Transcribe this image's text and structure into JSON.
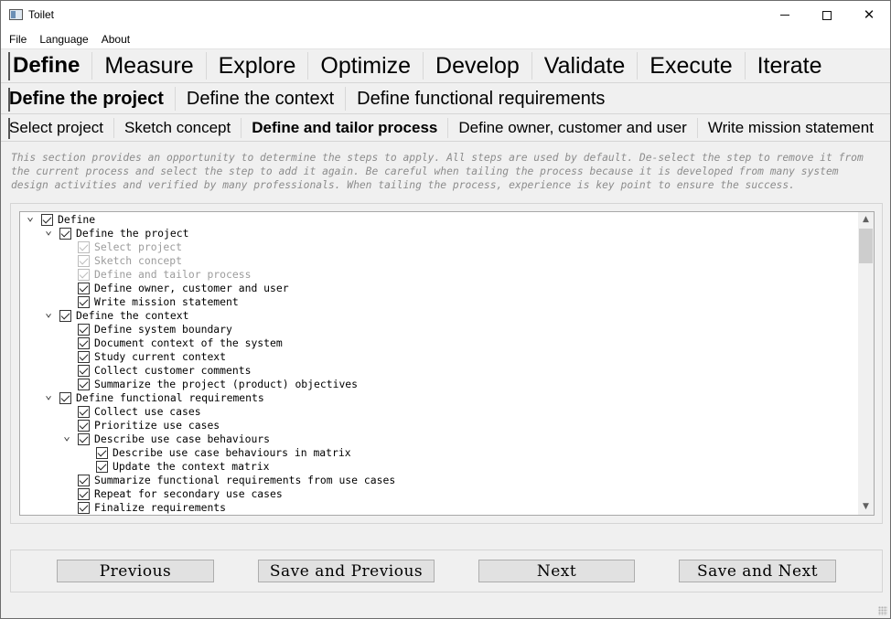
{
  "window": {
    "title": "Toilet"
  },
  "menu": [
    "File",
    "Language",
    "About"
  ],
  "phase_tabs": [
    "Define",
    "Measure",
    "Explore",
    "Optimize",
    "Develop",
    "Validate",
    "Execute",
    "Iterate"
  ],
  "phase_active": "Define",
  "step_tabs": [
    "Define the project",
    "Define the context",
    "Define functional requirements"
  ],
  "step_active": "Define the project",
  "substep_tabs": [
    "Select project",
    "Sketch concept",
    "Define and tailor process",
    "Define owner, customer and user",
    "Write mission statement"
  ],
  "substep_active": "Define and tailor process",
  "description": "This section provides an opportunity to determine the steps to apply. All steps are used by default. De-select the step to remove it from the current process and select the step to add it again. Be careful when tailing the process because it is developed from many system design activities and verified by many professionals. When tailing the process, experience is key point to ensure the success.",
  "tree": [
    {
      "label": "Define",
      "level": 0,
      "expanded": true,
      "checked": true,
      "disabled": false
    },
    {
      "label": "Define the project",
      "level": 1,
      "expanded": true,
      "checked": true,
      "disabled": false
    },
    {
      "label": "Select project",
      "level": 2,
      "checked": true,
      "disabled": true
    },
    {
      "label": "Sketch concept",
      "level": 2,
      "checked": true,
      "disabled": true
    },
    {
      "label": "Define and tailor process",
      "level": 2,
      "checked": true,
      "disabled": true
    },
    {
      "label": "Define owner, customer and user",
      "level": 2,
      "checked": true,
      "disabled": false
    },
    {
      "label": "Write mission statement",
      "level": 2,
      "checked": true,
      "disabled": false
    },
    {
      "label": "Define the context",
      "level": 1,
      "expanded": true,
      "checked": true,
      "disabled": false
    },
    {
      "label": "Define system boundary",
      "level": 2,
      "checked": true,
      "disabled": false
    },
    {
      "label": "Document context of the system",
      "level": 2,
      "checked": true,
      "disabled": false
    },
    {
      "label": "Study current context",
      "level": 2,
      "checked": true,
      "disabled": false
    },
    {
      "label": "Collect customer comments",
      "level": 2,
      "checked": true,
      "disabled": false
    },
    {
      "label": "Summarize the project (product) objectives",
      "level": 2,
      "checked": true,
      "disabled": false
    },
    {
      "label": "Define functional requirements",
      "level": 1,
      "expanded": true,
      "checked": true,
      "disabled": false
    },
    {
      "label": "Collect use cases",
      "level": 2,
      "checked": true,
      "disabled": false
    },
    {
      "label": "Prioritize use cases",
      "level": 2,
      "checked": true,
      "disabled": false
    },
    {
      "label": "Describe use case behaviours",
      "level": 2,
      "expanded": true,
      "checked": true,
      "disabled": false
    },
    {
      "label": "Describe use case behaviours in matrix",
      "level": 3,
      "checked": true,
      "disabled": false
    },
    {
      "label": "Update the context matrix",
      "level": 3,
      "checked": true,
      "disabled": false
    },
    {
      "label": "Summarize functional requirements from use cases",
      "level": 2,
      "checked": true,
      "disabled": false
    },
    {
      "label": "Repeat for secondary use cases",
      "level": 2,
      "checked": true,
      "disabled": false
    },
    {
      "label": "Finalize requirements",
      "level": 2,
      "checked": true,
      "disabled": false
    }
  ],
  "buttons": {
    "previous": "Previous",
    "save_previous": "Save and Previous",
    "next": "Next",
    "save_next": "Save and Next"
  },
  "icons": {
    "chevron_expanded": "chevron-down-icon",
    "scroll_up": "scroll-up-arrow-icon",
    "scroll_down": "scroll-down-arrow-icon"
  }
}
